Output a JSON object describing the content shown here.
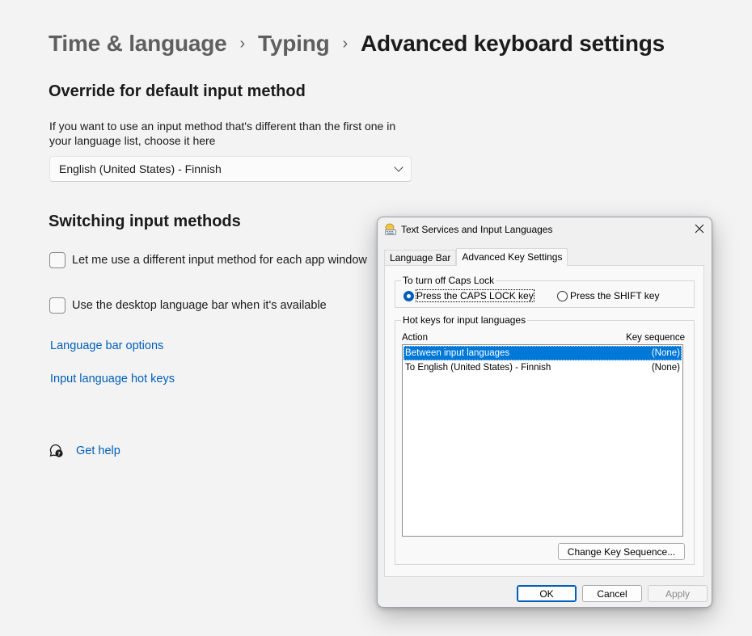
{
  "breadcrumb": {
    "items": [
      "Time & language",
      "Typing"
    ],
    "current": "Advanced keyboard settings"
  },
  "override": {
    "title": "Override for default input method",
    "description": "If you want to use an input method that's different than the first one in your language list, choose it here",
    "dropdown_value": "English (United States) - Finnish"
  },
  "switching": {
    "title": "Switching input methods",
    "checkboxes": [
      {
        "label": "Let me use a different input method for each app window",
        "checked": false
      },
      {
        "label": "Use the desktop language bar when it's available",
        "checked": false
      }
    ]
  },
  "links": {
    "language_bar_options": "Language bar options",
    "input_language_hot_keys": "Input language hot keys"
  },
  "help": {
    "label": "Get help",
    "icon": "help-chat-icon"
  },
  "dialog": {
    "title": "Text Services and Input Languages",
    "tabs": [
      "Language Bar",
      "Advanced Key Settings"
    ],
    "active_tab": "Advanced Key Settings",
    "caps_lock": {
      "legend": "To turn off Caps Lock",
      "options": [
        "Press the CAPS LOCK key",
        "Press the SHIFT key"
      ],
      "selected": "Press the CAPS LOCK key"
    },
    "hotkeys": {
      "legend": "Hot keys for input languages",
      "columns": [
        "Action",
        "Key sequence"
      ],
      "rows": [
        {
          "action": "Between input languages",
          "key": "(None)",
          "selected": true
        },
        {
          "action": "To English (United States) - Finnish",
          "key": "(None)",
          "selected": false
        }
      ]
    },
    "change_key_button": "Change Key Sequence...",
    "buttons": {
      "ok": "OK",
      "cancel": "Cancel",
      "apply": "Apply"
    }
  },
  "colors": {
    "link": "#005fb8",
    "selection": "#0078d7",
    "background": "#f3f3f3"
  }
}
